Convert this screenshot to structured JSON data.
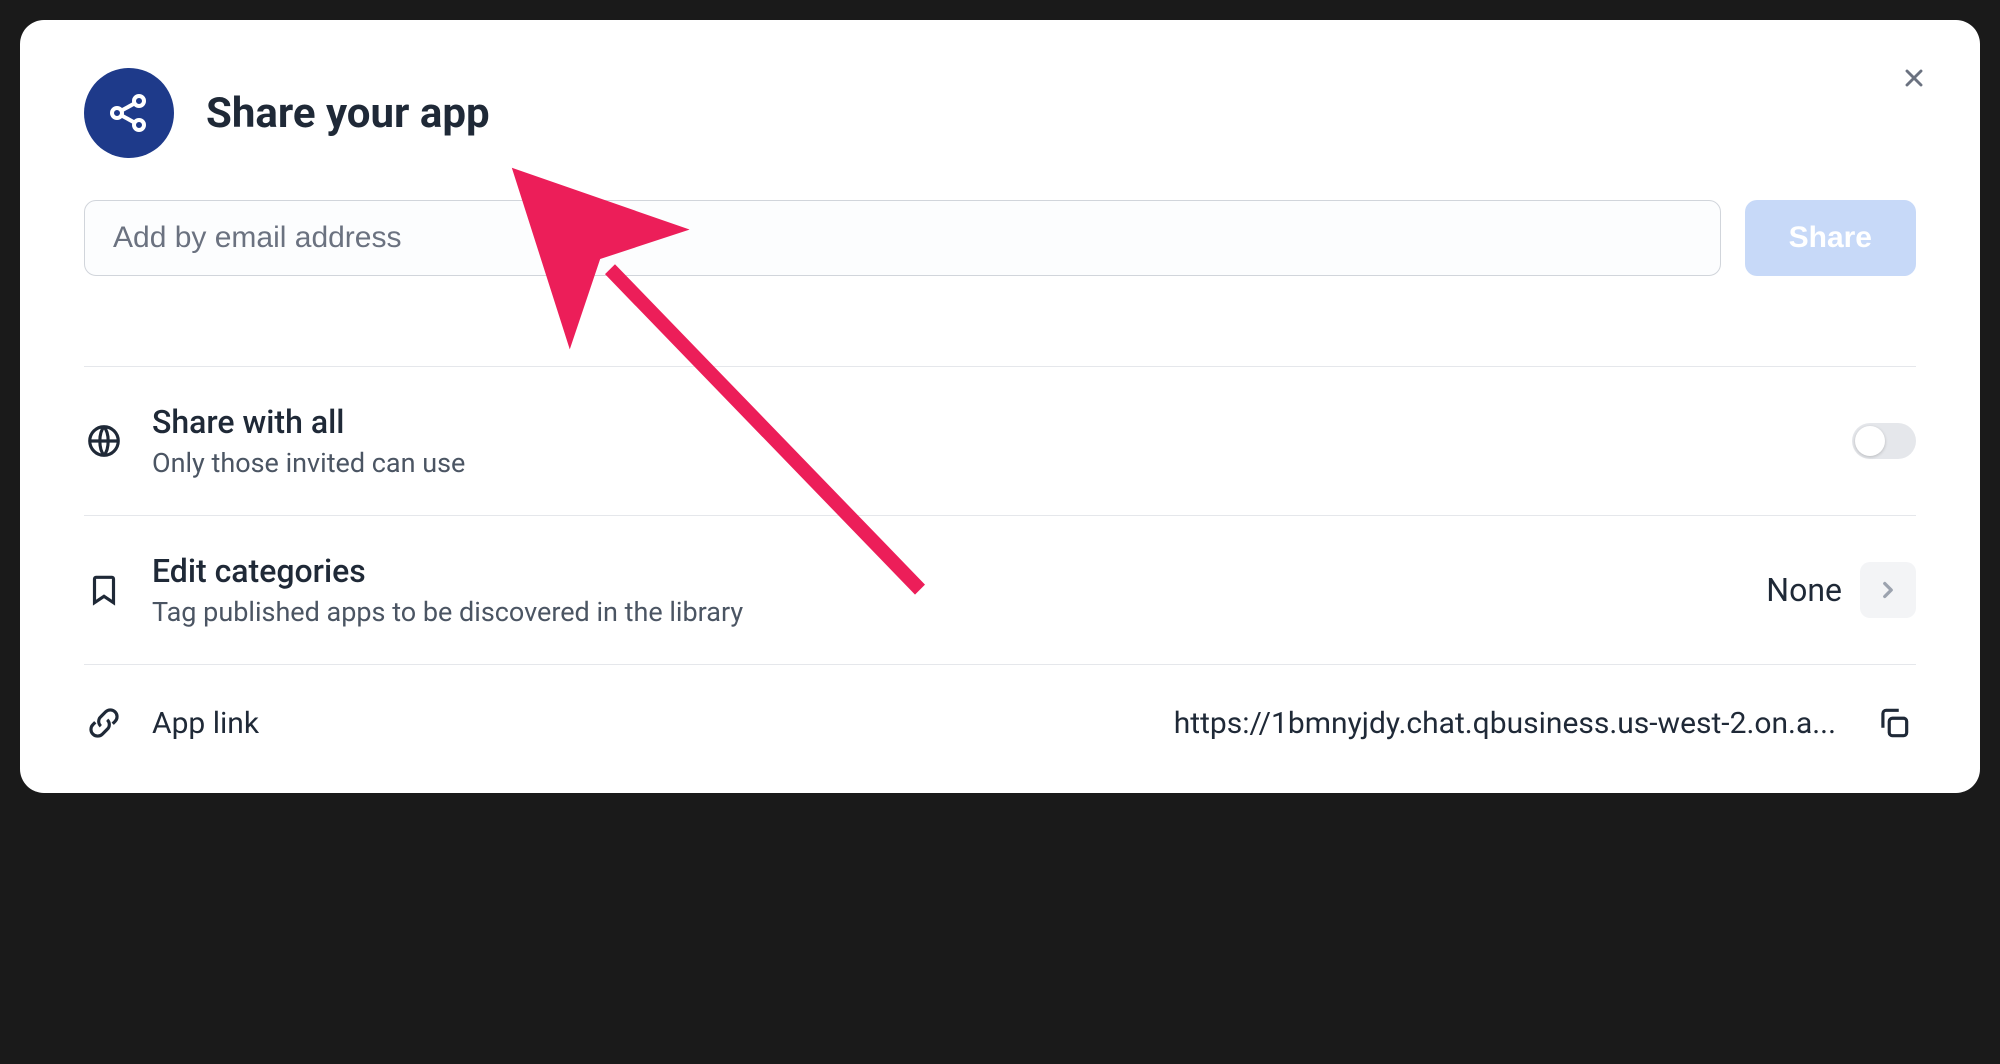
{
  "modal": {
    "title": "Share your app",
    "close_label": "Close"
  },
  "email": {
    "placeholder": "Add by email address",
    "value": "",
    "share_button_label": "Share"
  },
  "share_all": {
    "title": "Share with all",
    "subtitle": "Only those invited can use",
    "enabled": false
  },
  "categories": {
    "title": "Edit categories",
    "subtitle": "Tag published apps to be discovered in the library",
    "value": "None"
  },
  "app_link": {
    "label": "App link",
    "url": "https://1bmnyjdy.chat.qbusiness.us-west-2.on.a..."
  }
}
